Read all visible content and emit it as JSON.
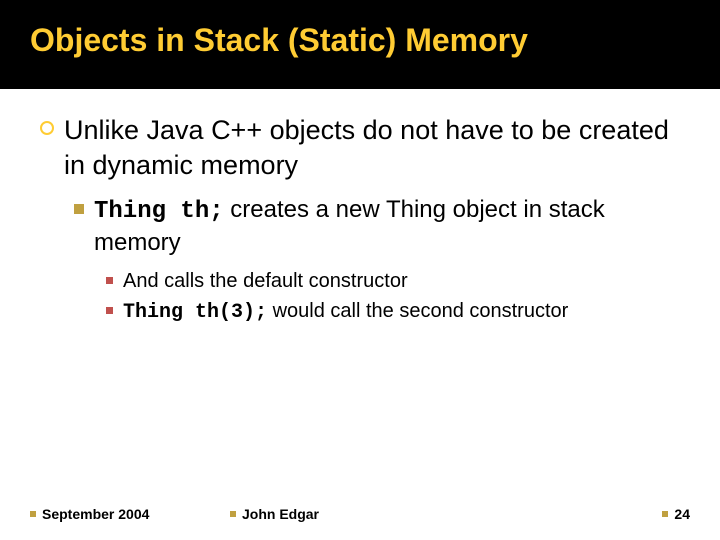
{
  "title": "Objects in Stack (Static) Memory",
  "bullets": {
    "l1": {
      "text": "Unlike Java C++ objects do not have to be created in dynamic memory"
    },
    "l2": {
      "code": "Thing th;",
      "rest": " creates a new Thing object in stack memory"
    },
    "l3a": {
      "text": "And calls the default constructor"
    },
    "l3b": {
      "code": "Thing th(3);",
      "rest": " would call the second constructor"
    }
  },
  "footer": {
    "date": "September 2004",
    "author": "John Edgar",
    "page": "24"
  }
}
